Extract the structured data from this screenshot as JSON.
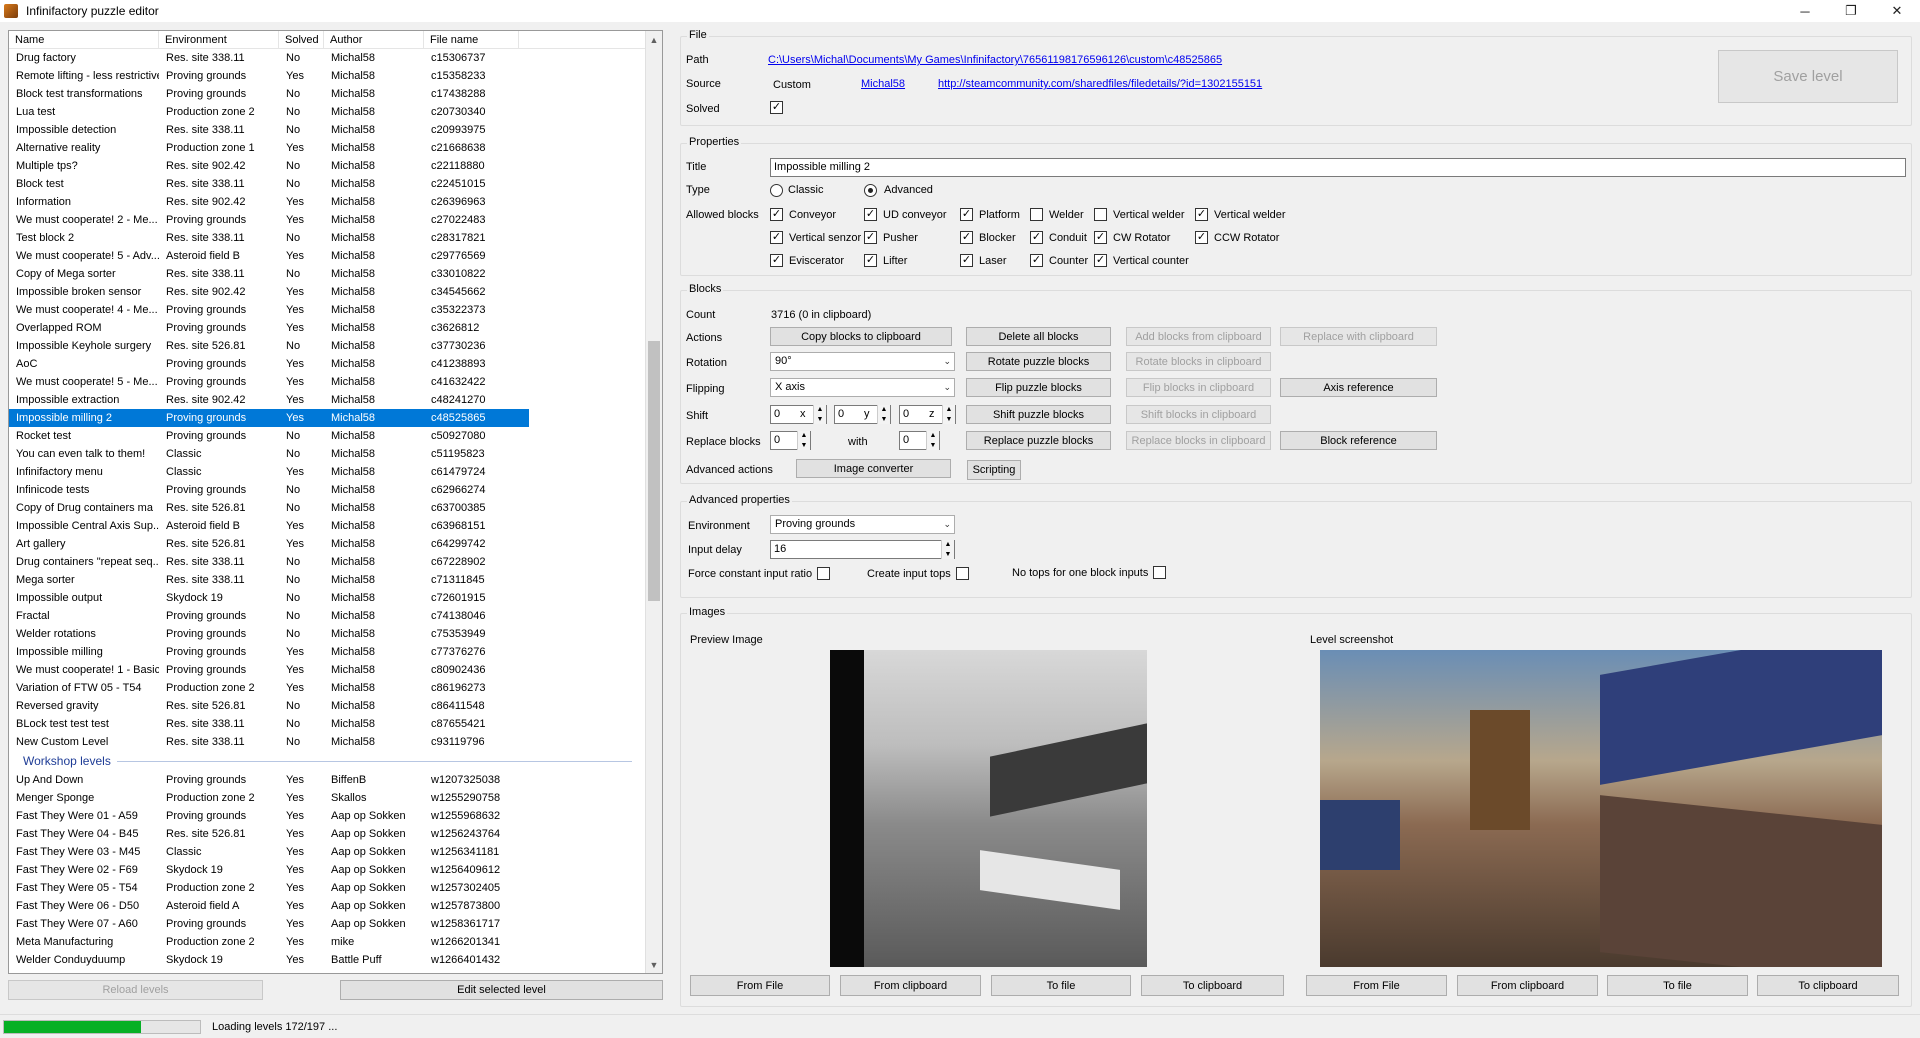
{
  "window": {
    "title": "Infinifactory puzzle editor",
    "minimize": "─",
    "maximize": "❐",
    "close": "✕"
  },
  "list": {
    "columns": [
      "Name",
      "Environment",
      "Solved",
      "Author",
      "File name"
    ],
    "rows": [
      [
        "Drug factory",
        "Res. site 338.11",
        "No",
        "Michal58",
        "c15306737"
      ],
      [
        "Remote lifting - less restrictive",
        "Proving grounds",
        "Yes",
        "Michal58",
        "c15358233"
      ],
      [
        "Block test transformations",
        "Proving grounds",
        "No",
        "Michal58",
        "c17438288"
      ],
      [
        "Lua test",
        "Production zone 2",
        "No",
        "Michal58",
        "c20730340"
      ],
      [
        "Impossible detection",
        "Res. site 338.11",
        "No",
        "Michal58",
        "c20993975"
      ],
      [
        "Alternative reality",
        "Production zone 1",
        "Yes",
        "Michal58",
        "c21668638"
      ],
      [
        "Multiple tps?",
        "Res. site 902.42",
        "No",
        "Michal58",
        "c22118880"
      ],
      [
        "Block test",
        "Res. site 338.11",
        "No",
        "Michal58",
        "c22451015"
      ],
      [
        "Information",
        "Res. site 902.42",
        "Yes",
        "Michal58",
        "c26396963"
      ],
      [
        "We must cooperate! 2 - Me...",
        "Proving grounds",
        "Yes",
        "Michal58",
        "c27022483"
      ],
      [
        "Test block 2",
        "Res. site 338.11",
        "No",
        "Michal58",
        "c28317821"
      ],
      [
        "We must cooperate! 5 - Adv...",
        "Asteroid field B",
        "Yes",
        "Michal58",
        "c29776569"
      ],
      [
        "Copy of Mega sorter",
        "Res. site 338.11",
        "No",
        "Michal58",
        "c33010822"
      ],
      [
        "Impossible broken sensor",
        "Res. site 902.42",
        "Yes",
        "Michal58",
        "c34545662"
      ],
      [
        "We must cooperate! 4 - Me...",
        "Proving grounds",
        "Yes",
        "Michal58",
        "c35322373"
      ],
      [
        "Overlapped ROM",
        "Proving grounds",
        "Yes",
        "Michal58",
        "c3626812"
      ],
      [
        "Impossible Keyhole surgery",
        "Res. site 526.81",
        "No",
        "Michal58",
        "c37730236"
      ],
      [
        "AoC",
        "Proving grounds",
        "Yes",
        "Michal58",
        "c41238893"
      ],
      [
        "We must cooperate! 5 - Me...",
        "Proving grounds",
        "Yes",
        "Michal58",
        "c41632422"
      ],
      [
        "Impossible extraction",
        "Res. site 902.42",
        "Yes",
        "Michal58",
        "c48241270"
      ],
      [
        "Impossible milling 2",
        "Proving grounds",
        "Yes",
        "Michal58",
        "c48525865"
      ],
      [
        "Rocket test",
        "Proving grounds",
        "No",
        "Michal58",
        "c50927080"
      ],
      [
        "You can even talk to them!",
        "Classic",
        "No",
        "Michal58",
        "c51195823"
      ],
      [
        "Infinifactory menu",
        "Classic",
        "Yes",
        "Michal58",
        "c61479724"
      ],
      [
        "Infinicode tests",
        "Proving grounds",
        "No",
        "Michal58",
        "c62966274"
      ],
      [
        "Copy of Drug containers ma",
        "Res. site 526.81",
        "No",
        "Michal58",
        "c63700385"
      ],
      [
        "Impossible Central Axis Sup...",
        "Asteroid field B",
        "Yes",
        "Michal58",
        "c63968151"
      ],
      [
        "Art gallery",
        "Res. site 526.81",
        "Yes",
        "Michal58",
        "c64299742"
      ],
      [
        "Drug containers \"repeat seq...",
        "Res. site 338.11",
        "No",
        "Michal58",
        "c67228902"
      ],
      [
        "Mega sorter",
        "Res. site 338.11",
        "No",
        "Michal58",
        "c71311845"
      ],
      [
        "Impossible output",
        "Skydock 19",
        "No",
        "Michal58",
        "c72601915"
      ],
      [
        "Fractal",
        "Proving grounds",
        "No",
        "Michal58",
        "c74138046"
      ],
      [
        "Welder rotations",
        "Proving grounds",
        "No",
        "Michal58",
        "c75353949"
      ],
      [
        "Impossible milling",
        "Proving grounds",
        "Yes",
        "Michal58",
        "c77376276"
      ],
      [
        "We must cooperate! 1 - Basic",
        "Proving grounds",
        "Yes",
        "Michal58",
        "c80902436"
      ],
      [
        "Variation of FTW 05 - T54",
        "Production zone 2",
        "Yes",
        "Michal58",
        "c86196273"
      ],
      [
        "Reversed gravity",
        "Res. site 526.81",
        "No",
        "Michal58",
        "c86411548"
      ],
      [
        "BLock test test test",
        "Res. site 338.11",
        "No",
        "Michal58",
        "c87655421"
      ],
      [
        "New Custom Level",
        "Res. site 338.11",
        "No",
        "Michal58",
        "c93119796"
      ]
    ],
    "selected_index": 20,
    "workshop_group": "Workshop levels",
    "workshop_rows": [
      [
        "Up And Down",
        "Proving grounds",
        "Yes",
        "BiffenB",
        "w1207325038"
      ],
      [
        "Menger Sponge",
        "Production zone 2",
        "Yes",
        "Skallos",
        "w1255290758"
      ],
      [
        "Fast They Were 01 - A59",
        "Proving grounds",
        "Yes",
        "Aap op Sokken",
        "w1255968632"
      ],
      [
        "Fast They Were 04 - B45",
        "Res. site 526.81",
        "Yes",
        "Aap op Sokken",
        "w1256243764"
      ],
      [
        "Fast They Were 03 - M45",
        "Classic",
        "Yes",
        "Aap op Sokken",
        "w1256341181"
      ],
      [
        "Fast They Were 02 - F69",
        "Skydock 19",
        "Yes",
        "Aap op Sokken",
        "w1256409612"
      ],
      [
        "Fast They Were 05 - T54",
        "Production zone 2",
        "Yes",
        "Aap op Sokken",
        "w1257302405"
      ],
      [
        "Fast They Were 06 - D50",
        "Asteroid field A",
        "Yes",
        "Aap op Sokken",
        "w1257873800"
      ],
      [
        "Fast They Were 07 - A60",
        "Proving grounds",
        "Yes",
        "Aap op Sokken",
        "w1258361717"
      ],
      [
        "Meta Manufacturing",
        "Production zone 2",
        "Yes",
        "mike",
        "w1266201341"
      ],
      [
        "Welder Conduyduump",
        "Skydock 19",
        "Yes",
        "Battle Puff",
        "w1266401432"
      ]
    ]
  },
  "bottom_buttons": {
    "reload": "Reload levels",
    "edit": "Edit selected level"
  },
  "status": {
    "text": "Loading levels 172/197 ...",
    "progress": 0.7
  },
  "file": {
    "group": "File",
    "path_label": "Path",
    "path": "C:\\Users\\Michal\\Documents\\My Games\\Infinifactory\\76561198176596126\\custom\\c48525865",
    "source_label": "Source",
    "source": "Custom",
    "author": "Michal58",
    "url": "http://steamcommunity.com/sharedfiles/filedetails/?id=1302155151",
    "solved_label": "Solved",
    "save": "Save level"
  },
  "properties": {
    "group": "Properties",
    "title_label": "Title",
    "title": "Impossible milling 2",
    "type_label": "Type",
    "type_classic": "Classic",
    "type_advanced": "Advanced",
    "allowed_label": "Allowed blocks",
    "blocks": [
      [
        "Conveyor",
        "UD conveyor",
        "Platform",
        "Welder",
        "Vertical welder",
        "Vertical welder"
      ],
      [
        "Vertical senzor",
        "Pusher",
        "Blocker",
        "Conduit",
        "CW Rotator",
        "CCW Rotator"
      ],
      [
        "Eviscerator",
        "Lifter",
        "Laser",
        "Counter",
        "Vertical counter"
      ]
    ],
    "blocks_checked": [
      [
        true,
        true,
        true,
        false,
        false,
        true
      ],
      [
        true,
        true,
        true,
        true,
        true,
        true
      ],
      [
        true,
        true,
        true,
        true,
        true
      ]
    ]
  },
  "blocks": {
    "group": "Blocks",
    "count_label": "Count",
    "count": "3716 (0 in clipboard)",
    "actions_label": "Actions",
    "copy": "Copy blocks to clipboard",
    "delete": "Delete all blocks",
    "add_clip": "Add blocks from clipboard",
    "replace_clip": "Replace with clipboard",
    "rotation_label": "Rotation",
    "rotation": "90°",
    "rotate": "Rotate puzzle blocks",
    "rotate_clip": "Rotate blocks in clipboard",
    "flipping_label": "Flipping",
    "flipping": "X axis",
    "flip": "Flip puzzle blocks",
    "flip_clip": "Flip blocks in clipboard",
    "axis_ref": "Axis reference",
    "shift_label": "Shift",
    "shift_x": "0",
    "shift_y": "0",
    "shift_z": "0",
    "x": "x",
    "y": "y",
    "z": "z",
    "shift": "Shift puzzle blocks",
    "shift_clip": "Shift blocks in clipboard",
    "replace_label": "Replace blocks",
    "replace_from": "0",
    "with": "with",
    "replace_to": "0",
    "replace": "Replace puzzle blocks",
    "replace_in_clip": "Replace blocks in clipboard",
    "block_ref": "Block reference",
    "adv_label": "Advanced actions",
    "image_conv": "Image converter",
    "scripting": "Scripting"
  },
  "advanced": {
    "group": "Advanced properties",
    "env_label": "Environment",
    "env": "Proving grounds",
    "delay_label": "Input delay",
    "delay": "16",
    "force": "Force constant input ratio",
    "tops": "Create input tops",
    "notops": "No tops for one block inputs"
  },
  "images": {
    "group": "Images",
    "preview": "Preview Image",
    "screenshot": "Level screenshot",
    "from_file": "From File",
    "from_clip": "From clipboard",
    "to_file": "To file",
    "to_clip": "To clipboard"
  }
}
